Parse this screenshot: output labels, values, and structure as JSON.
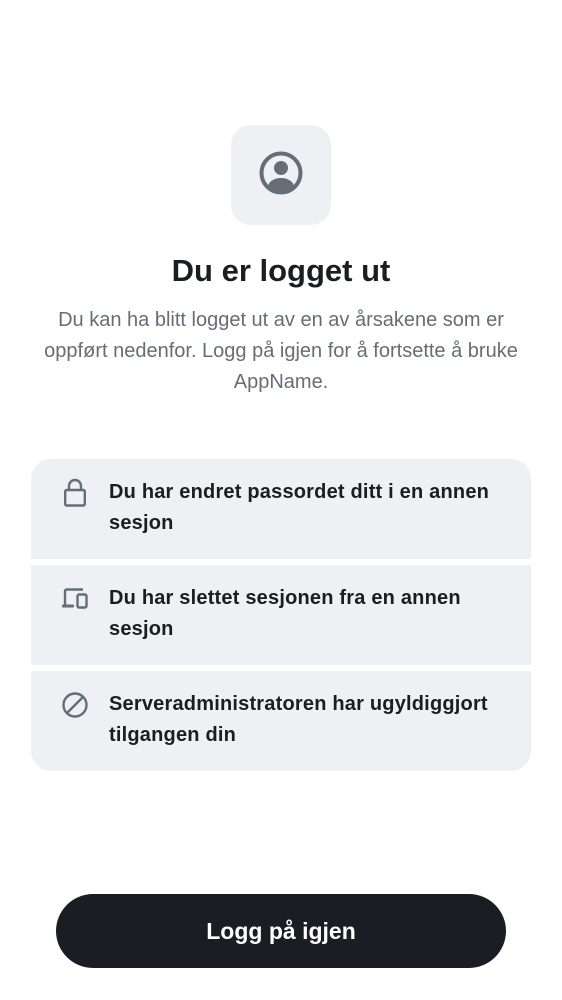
{
  "header": {
    "icon": "user-circle-icon",
    "title": "Du er logget ut",
    "description": "Du kan ha blitt logget ut av en av årsakene som er oppført nedenfor. Logg på igjen for å fortsette å bruke AppName."
  },
  "reasons": [
    {
      "icon": "lock-icon",
      "text": "Du har endret passordet ditt i en annen sesjon"
    },
    {
      "icon": "devices-icon",
      "text": "Du har slettet sesjonen fra en annen sesjon"
    },
    {
      "icon": "block-icon",
      "text": "Serveradministratoren har ugyldiggjort tilgangen din"
    }
  ],
  "actions": {
    "sign_in_again_label": "Logg på igjen"
  },
  "colors": {
    "background": "#ffffff",
    "surface": "#eef0f4",
    "text_primary": "#1b1d22",
    "text_secondary": "#656d77",
    "icon": "#656d77",
    "button_bg": "#1b1d22",
    "button_text": "#ffffff"
  }
}
